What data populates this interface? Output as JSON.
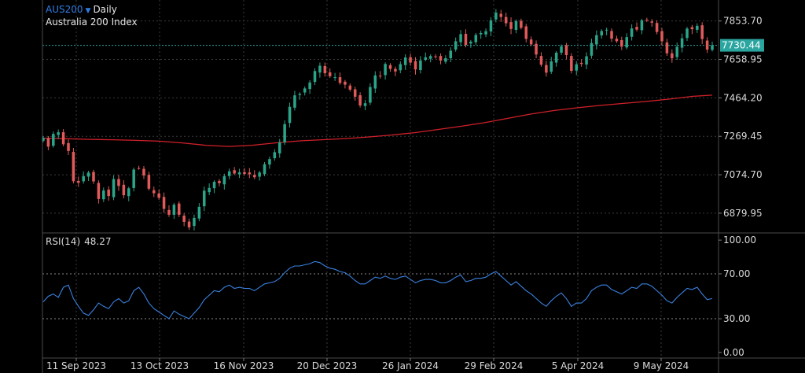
{
  "header": {
    "symbol": "AUS200",
    "timeframe": "Daily",
    "instrument_name": "Australia 200 Index",
    "dropdown_icon": "caret-down-icon"
  },
  "rsi_header": {
    "label": "RSI(14)",
    "value": "48.27"
  },
  "colors": {
    "background": "#000000",
    "bull": "#2ba58a",
    "bear": "#e05a5a",
    "ma_line": "#d0202a",
    "rsi_line": "#3a82e0",
    "price_line": "#2ba5a0",
    "text": "#d9d9d9",
    "grid": "#3a3a3a"
  },
  "chart_data": [
    {
      "type": "candlestick",
      "title": "AUS200 Daily",
      "y_ticks": [
        7853.7,
        7658.95,
        7464.2,
        7269.45,
        7074.7,
        6879.95
      ],
      "y_tick_labels": [
        "7853.70",
        "7658.95",
        "7464.20",
        "7269.45",
        "7074.70",
        "6879.95"
      ],
      "ylim": [
        6780,
        7960
      ],
      "x_labels": [
        "11 Sep 2023",
        "13 Oct 2023",
        "16 Nov 2023",
        "20 Dec 2023",
        "26 Jan 2024",
        "29 Feb 2024",
        "5 Apr 2024",
        "9 May 2024"
      ],
      "current_price": 7730.44,
      "current_price_label": "7730.44",
      "moving_average": [
        [
          0,
          7260
        ],
        [
          12,
          7257
        ],
        [
          24,
          7254
        ],
        [
          36,
          7252
        ],
        [
          48,
          7249
        ],
        [
          60,
          7245
        ],
        [
          72,
          7236
        ],
        [
          84,
          7224
        ],
        [
          96,
          7218
        ],
        [
          108,
          7224
        ],
        [
          120,
          7236
        ],
        [
          132,
          7246
        ],
        [
          144,
          7252
        ],
        [
          156,
          7258
        ],
        [
          168,
          7266
        ],
        [
          180,
          7276
        ],
        [
          192,
          7288
        ],
        [
          204,
          7304
        ],
        [
          216,
          7320
        ],
        [
          228,
          7338
        ],
        [
          240,
          7360
        ],
        [
          252,
          7382
        ],
        [
          264,
          7400
        ],
        [
          276,
          7414
        ],
        [
          288,
          7426
        ],
        [
          300,
          7436
        ],
        [
          312,
          7446
        ],
        [
          324,
          7458
        ],
        [
          336,
          7472
        ],
        [
          346,
          7478
        ]
      ],
      "candle_closes": [
        7262,
        7217,
        7282,
        7290,
        7229,
        7195,
        7042,
        7034,
        7068,
        7086,
        7041,
        6952,
        6995,
        6967,
        7053,
        7018,
        6971,
        7006,
        7101,
        7108,
        7071,
        7004,
        6981,
        6958,
        6902,
        6872,
        6923,
        6872,
        6836,
        6808,
        6856,
        6912,
        6994,
        7008,
        7039,
        7032,
        7068,
        7092,
        7081,
        7087,
        7079,
        7077,
        7062,
        7086,
        7128,
        7154,
        7189,
        7239,
        7331,
        7419,
        7477,
        7484,
        7512,
        7542,
        7600,
        7627,
        7589,
        7574,
        7569,
        7540,
        7531,
        7506,
        7470,
        7426,
        7437,
        7519,
        7578,
        7575,
        7636,
        7611,
        7598,
        7635,
        7669,
        7643,
        7608,
        7654,
        7670,
        7676,
        7672,
        7653,
        7665,
        7703,
        7751,
        7787,
        7732,
        7749,
        7783,
        7793,
        7802,
        7857,
        7896,
        7874,
        7842,
        7813,
        7853,
        7819,
        7763,
        7735,
        7684,
        7632,
        7592,
        7649,
        7693,
        7725,
        7681,
        7601,
        7634,
        7636,
        7675,
        7742,
        7782,
        7803,
        7809,
        7764,
        7751,
        7724,
        7772,
        7816,
        7810,
        7857,
        7859,
        7845,
        7798,
        7751,
        7690,
        7665,
        7723,
        7766,
        7815,
        7812,
        7829,
        7762,
        7709,
        7730
      ]
    },
    {
      "type": "line",
      "title": "RSI(14) 48.27",
      "y_ticks": [
        100,
        70,
        30,
        0
      ],
      "y_tick_labels": [
        "100.00",
        "70.00",
        "30.00",
        "0.00"
      ],
      "ylim": [
        -5,
        105
      ],
      "reference_lines": [
        70,
        30
      ],
      "values": [
        45,
        50,
        52,
        49,
        58,
        60,
        48,
        41,
        35,
        33,
        38,
        44,
        41,
        39,
        45,
        48,
        44,
        46,
        55,
        58,
        52,
        44,
        39,
        36,
        33,
        30,
        37,
        34,
        32,
        30,
        35,
        40,
        47,
        51,
        55,
        54,
        58,
        60,
        57,
        58,
        57,
        57,
        55,
        58,
        61,
        62,
        63,
        66,
        71,
        75,
        77,
        77,
        78,
        79,
        81,
        80,
        77,
        75,
        74,
        72,
        71,
        68,
        64,
        61,
        61,
        64,
        67,
        66,
        68,
        66,
        65,
        67,
        68,
        65,
        62,
        64,
        65,
        65,
        64,
        62,
        62,
        64,
        67,
        69,
        63,
        64,
        66,
        66,
        67,
        70,
        72,
        68,
        64,
        60,
        63,
        59,
        55,
        52,
        48,
        44,
        41,
        46,
        50,
        53,
        48,
        41,
        44,
        44,
        48,
        55,
        58,
        60,
        60,
        56,
        54,
        52,
        55,
        58,
        57,
        61,
        61,
        59,
        55,
        51,
        46,
        44,
        49,
        53,
        57,
        56,
        58,
        52,
        47,
        48
      ]
    }
  ]
}
